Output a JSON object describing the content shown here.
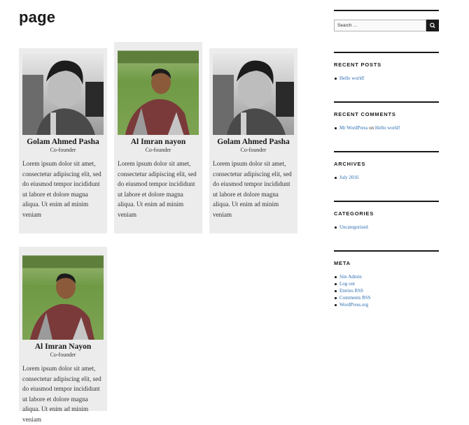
{
  "page": {
    "title": "page"
  },
  "team": [
    {
      "name": "Golam Ahmed Pasha",
      "role": "Co-founder",
      "bio": "Lorem ipsum dolor sit amet, consectetur adipiscing elit, sed do eiusmod tempor incididunt ut labore et dolore magna aliqua. Ut enim ad minim veniam",
      "photo": "grayscale-portrait"
    },
    {
      "name": "Al Imran nayon",
      "role": "Co-founder",
      "bio": "Lorem ipsum dolor sit amet, consectetur adipiscing elit, sed do eiusmod tempor incididunt ut labore et dolore magna aliqua. Ut enim ad minim veniam",
      "photo": "outdoor-portrait"
    },
    {
      "name": "Golam Ahmed Pasha",
      "role": "Co-founder",
      "bio": "Lorem ipsum dolor sit amet, consectetur adipiscing elit, sed do eiusmod tempor incididunt ut labore et dolore magna aliqua. Ut enim ad minim veniam",
      "photo": "grayscale-portrait"
    },
    {
      "name": "Al Imran Nayon",
      "role": "Co-founder",
      "bio": "Lorem ipsum dolor sit amet, consectetur adipiscing elit, sed do eiusmod tempor incididunt ut labore et dolore magna aliqua. Ut enim ad minim veniam",
      "photo": "outdoor-portrait"
    }
  ],
  "sidebar": {
    "search": {
      "placeholder": "Search …",
      "button_icon": "search-icon"
    },
    "recent_posts": {
      "title": "RECENT POSTS",
      "items": [
        "Hello world!"
      ]
    },
    "recent_comments": {
      "title": "RECENT COMMENTS",
      "author": "Mr WordPress",
      "on": "on",
      "post": "Hello world!"
    },
    "archives": {
      "title": "ARCHIVES",
      "items": [
        "July 2016"
      ]
    },
    "categories": {
      "title": "CATEGORIES",
      "items": [
        "Uncategorized"
      ]
    },
    "meta": {
      "title": "META",
      "items": [
        "Site Admin",
        "Log out",
        "Entries RSS",
        "Comments RSS",
        "WordPress.org"
      ]
    }
  },
  "colors": {
    "link": "#2b6cb0",
    "card_bg": "#ececec",
    "text": "#1a1a1a"
  }
}
